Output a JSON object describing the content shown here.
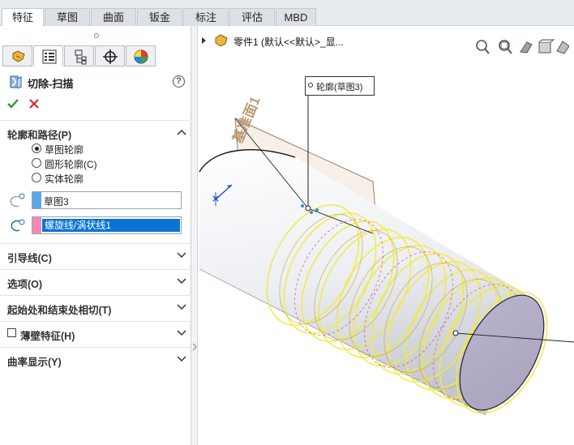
{
  "tabs": [
    {
      "label": "特征",
      "active": true
    },
    {
      "label": "草图",
      "active": false
    },
    {
      "label": "曲面",
      "active": false
    },
    {
      "label": "钣金",
      "active": false
    },
    {
      "label": "标注",
      "active": false
    },
    {
      "label": "评估",
      "active": false
    },
    {
      "label": "MBD",
      "active": false
    }
  ],
  "feature": {
    "title": "切除-扫描",
    "ok_icon": "checkmark-icon",
    "cancel_icon": "x-icon",
    "help_icon": "help-icon"
  },
  "profile_section": {
    "title": "轮廓和路径(P)",
    "options": [
      {
        "label": "草图轮廓",
        "selected": true
      },
      {
        "label": "圆形轮廓(C)",
        "selected": false
      },
      {
        "label": "实体轮廓",
        "selected": false
      }
    ],
    "profile_value": "草图3",
    "path_value": "螺旋线/涡状线1",
    "profile_color": "#5aa8e8",
    "path_color": "#f08bb7"
  },
  "sections": [
    {
      "title": "引导线(C)"
    },
    {
      "title": "选项(O)"
    },
    {
      "title": "起始处和结束处相切(T)"
    },
    {
      "title": "薄壁特征(H)",
      "checkbox": true,
      "checked": false
    },
    {
      "title": "曲率显示(Y)"
    }
  ],
  "tree": {
    "label": "零件1 (默认<<默认>_显..."
  },
  "callout": {
    "label": "轮廓(草图3)"
  },
  "plane": {
    "label": "基准面1"
  },
  "colors": {
    "helix": "#f2ea3a",
    "accent": "#0a74d6",
    "plane": "#c8b59b"
  }
}
